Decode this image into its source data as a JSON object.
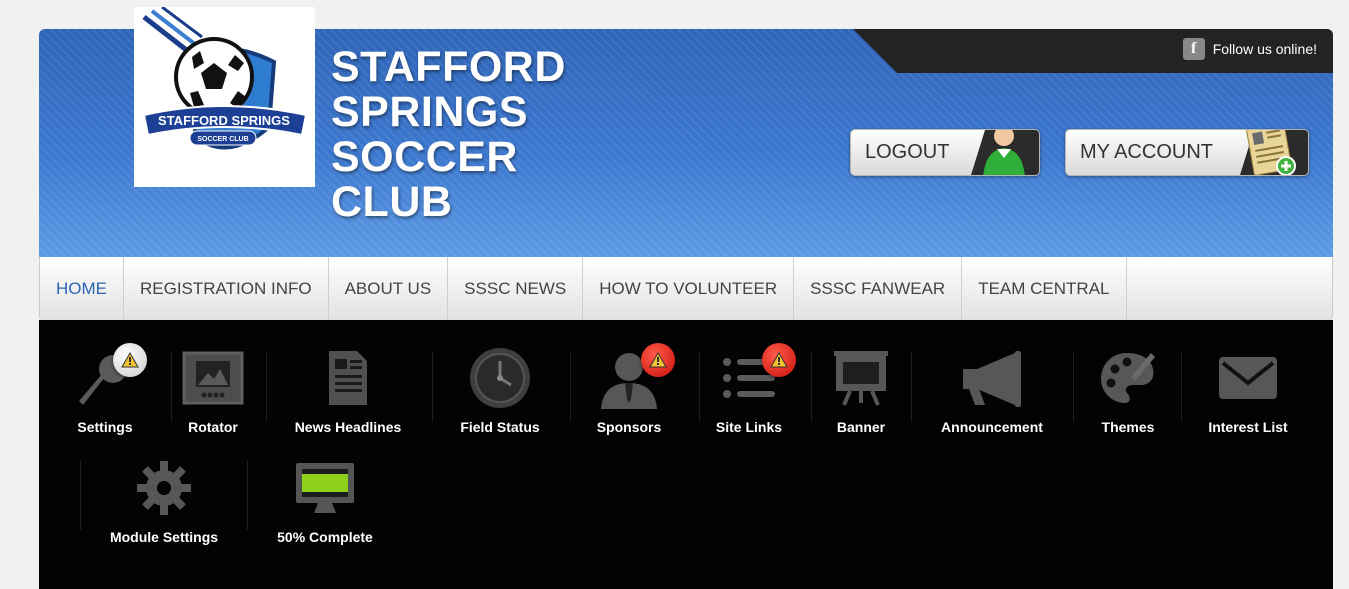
{
  "header": {
    "follow_text": "Follow us online!",
    "facebook_icon_glyph": "f",
    "site_title_lines": [
      "STAFFORD",
      "SPRINGS",
      "SOCCER",
      "CLUB"
    ],
    "logo_text": "STAFFORD SPRINGS",
    "logo_subtext": "SOCCER CLUB",
    "logout_label": "LOGOUT",
    "logout_icon": "user-icon",
    "myaccount_label": "MY ACCOUNT",
    "myaccount_icon": "account-card-icon"
  },
  "nav": {
    "items": [
      {
        "label": "HOME",
        "active": true
      },
      {
        "label": "REGISTRATION INFO"
      },
      {
        "label": "ABOUT US"
      },
      {
        "label": "SSSC NEWS"
      },
      {
        "label": "HOW TO VOLUNTEER"
      },
      {
        "label": "SSSC FANWEAR"
      },
      {
        "label": "TEAM CENTRAL"
      }
    ]
  },
  "admin_tools": {
    "row1": [
      {
        "label": "Settings",
        "icon": "microphone-icon",
        "badge": "warning-white"
      },
      {
        "label": "Rotator",
        "icon": "image-icon"
      },
      {
        "label": "News Headlines",
        "icon": "document-icon"
      },
      {
        "label": "Field Status",
        "icon": "clock-icon"
      },
      {
        "label": "Sponsors",
        "icon": "person-icon",
        "badge": "warning-red"
      },
      {
        "label": "Site Links",
        "icon": "list-icon",
        "badge": "warning-red"
      },
      {
        "label": "Banner",
        "icon": "easel-icon"
      },
      {
        "label": "Announcement",
        "icon": "megaphone-icon"
      },
      {
        "label": "Themes",
        "icon": "palette-icon"
      },
      {
        "label": "Interest List",
        "icon": "envelope-icon"
      }
    ],
    "row2": [
      {
        "label": "Module Settings",
        "icon": "gear-icon"
      },
      {
        "label": "50% Complete",
        "icon": "monitor-progress-icon",
        "progress": 0.5
      }
    ]
  },
  "colors": {
    "header_blue": "#3c78cf",
    "nav_active": "#2b63b3",
    "panel_bg": "#030303",
    "badge_red": "#c80f08",
    "progress_green": "#8ed11b"
  }
}
